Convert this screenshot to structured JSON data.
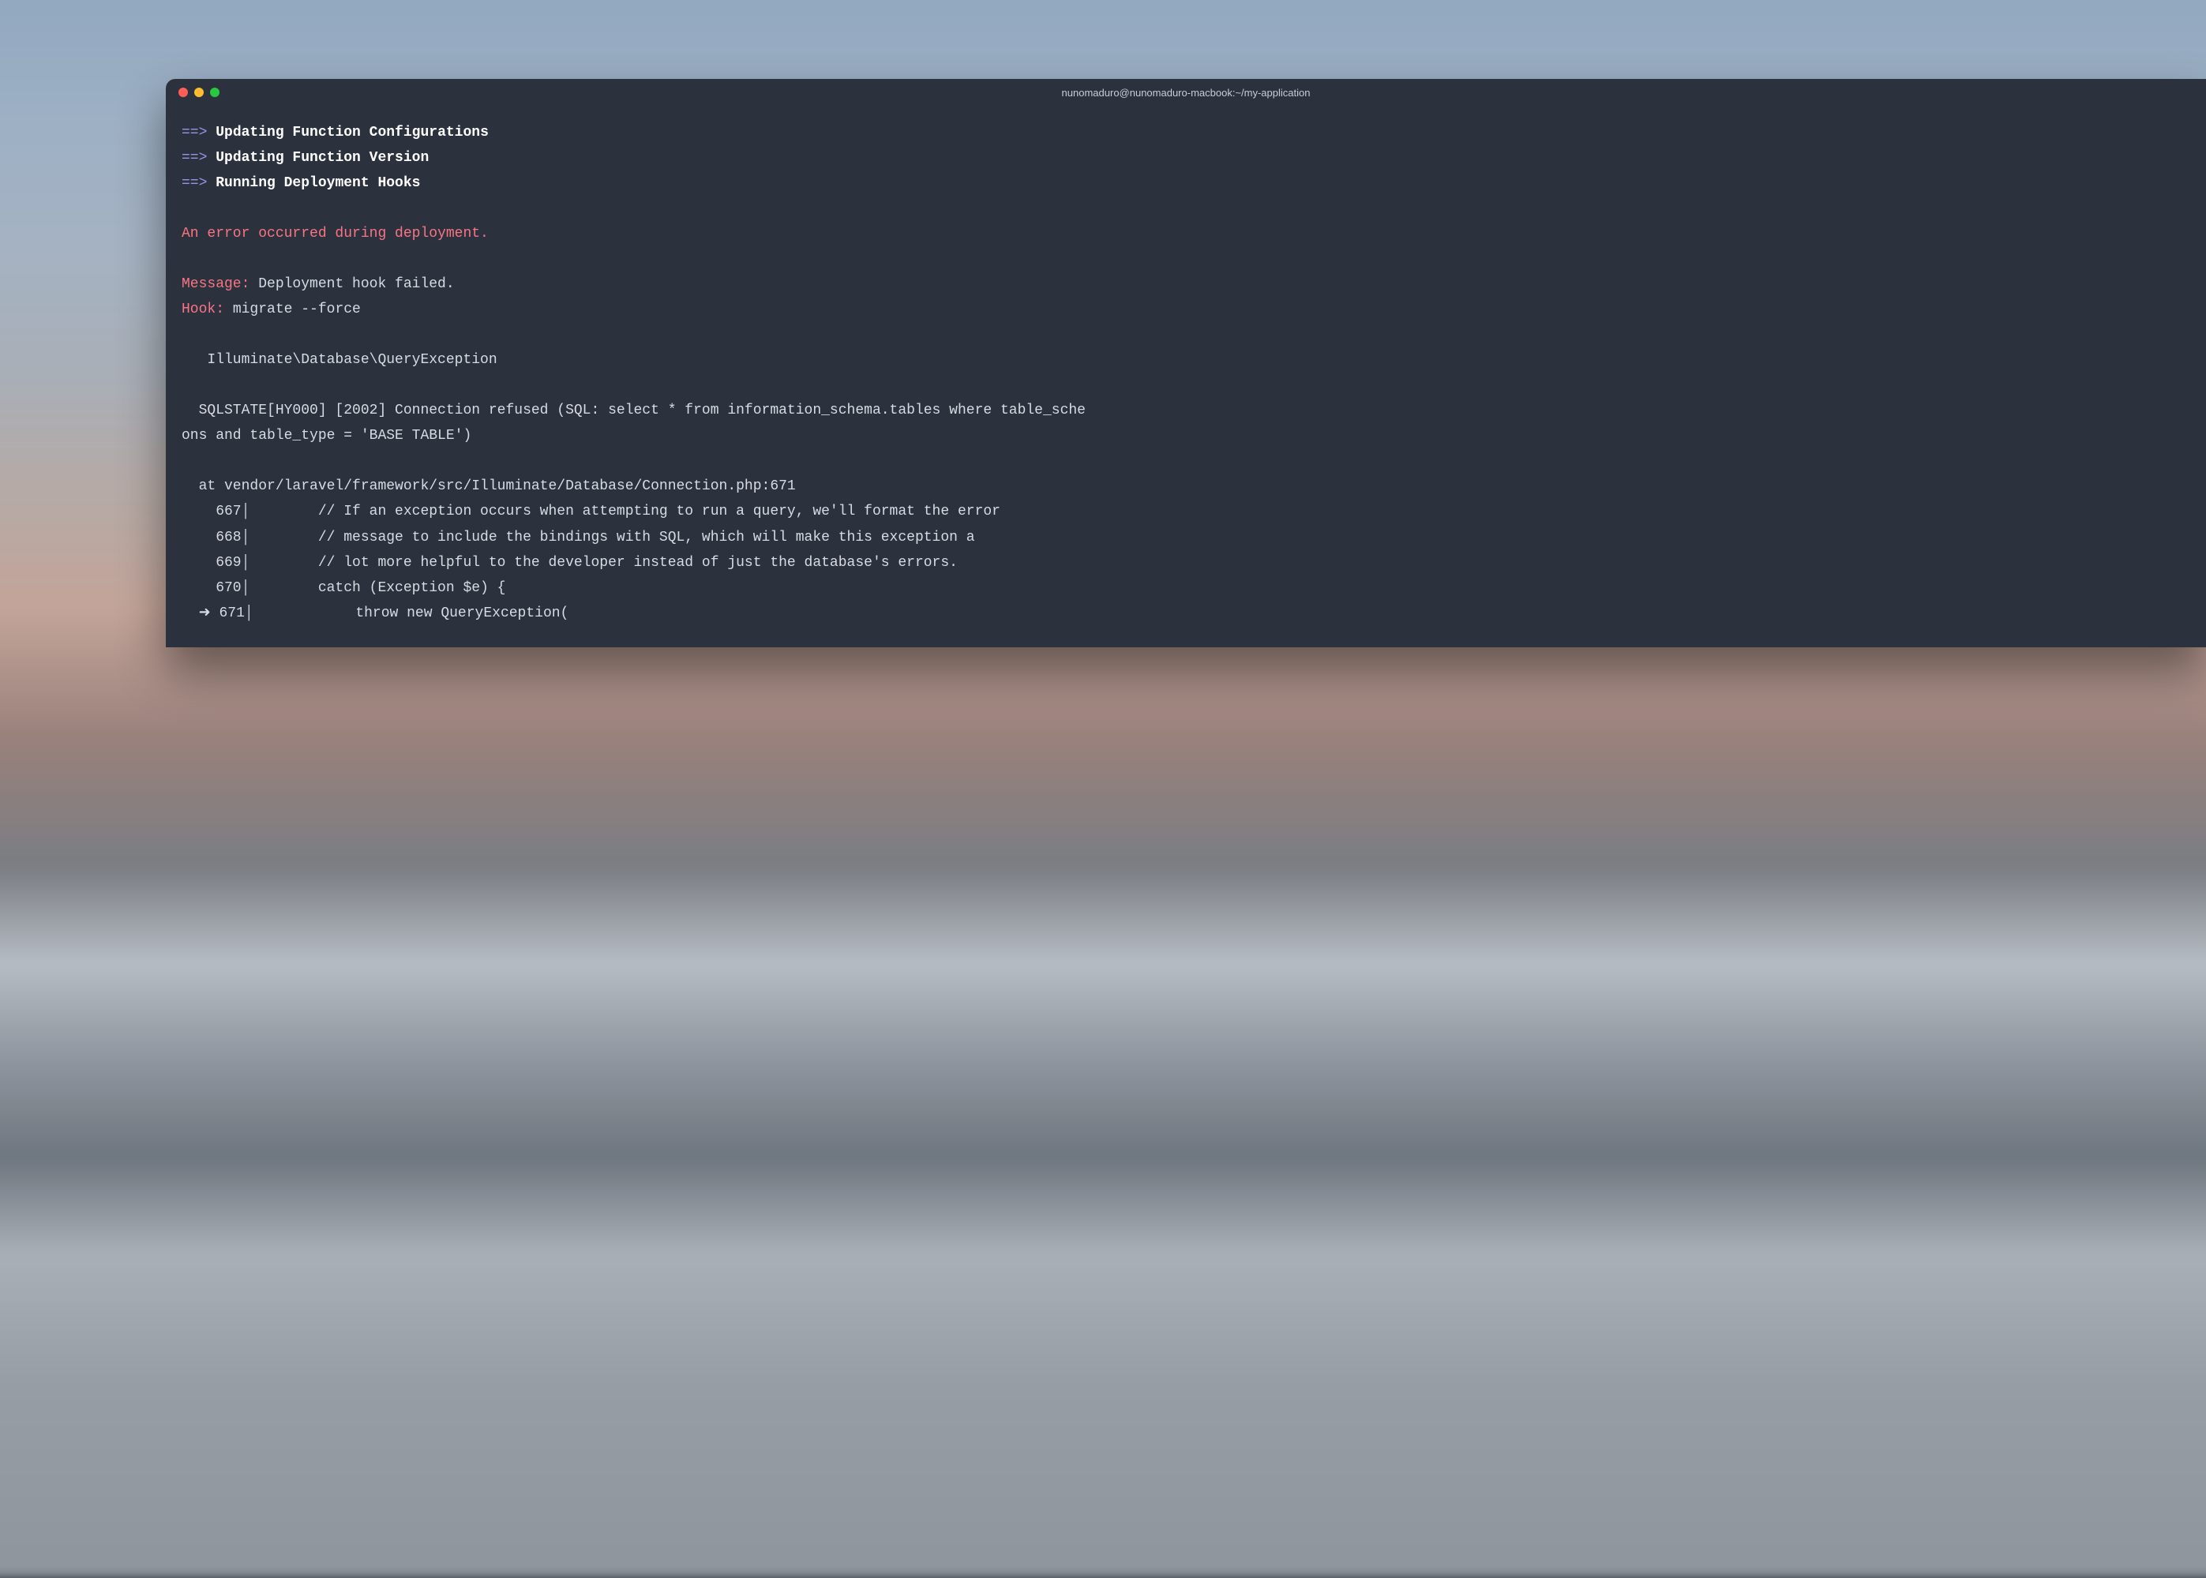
{
  "window": {
    "title": "nunomaduro@nunomaduro-macbook:~/my-application"
  },
  "output": {
    "arrow": "==>",
    "steps": [
      "Updating Function Configurations",
      "Updating Function Version",
      "Running Deployment Hooks"
    ],
    "error_line": "An error occurred during deployment.",
    "message_label": "Message:",
    "message_value": " Deployment hook failed.",
    "hook_label": "Hook:",
    "hook_value": " migrate --force",
    "exception": "   Illuminate\\Database\\QueryException ",
    "sql_1": "  SQLSTATE[HY000] [2002] Connection refused (SQL: select * from information_schema.tables where table_sche",
    "sql_2": "ons and table_type = 'BASE TABLE')",
    "at_line": "  at vendor/laravel/framework/src/Illuminate/Database/Connection.php:671",
    "code": {
      "l667": "    667│        // If an exception occurs when attempting to run a query, we'll format the error",
      "l668": "    668│        // message to include the bindings with SQL, which will make this exception a",
      "l669": "    669│        // lot more helpful to the developer instead of just the database's errors.",
      "l670": "    670│        catch (Exception $e) {",
      "l671": "  ➜ 671│            throw new QueryException("
    }
  }
}
